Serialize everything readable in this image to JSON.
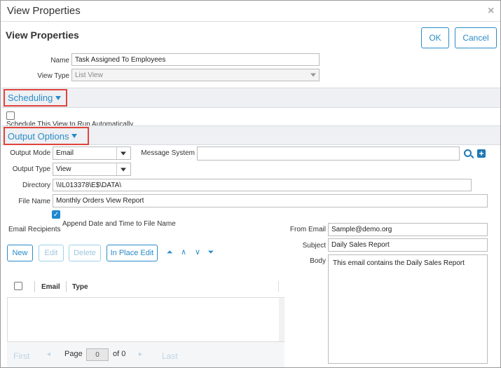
{
  "window": {
    "title": "View Properties",
    "close_glyph": "×"
  },
  "header": {
    "title": "View Properties",
    "ok_label": "OK",
    "cancel_label": "Cancel"
  },
  "general": {
    "name_label": "Name",
    "name_value": "Task Assigned To Employees",
    "view_type_label": "View Type",
    "view_type_value": "List View"
  },
  "scheduling": {
    "title": "Scheduling",
    "checkbox_label": "Schedule This View to Run Automatically",
    "checked": false
  },
  "output_options": {
    "title": "Output Options",
    "output_mode_label": "Output Mode",
    "output_mode_value": "Email",
    "message_system_label": "Message System",
    "message_system_value": "",
    "output_type_label": "Output Type",
    "output_type_value": "View",
    "directory_label": "Directory",
    "directory_value": "\\\\IL013378\\E$\\DATA\\",
    "file_name_label": "File Name",
    "file_name_value": "Monthly  Orders View Report",
    "append_label": "Append Date and Time to File Name",
    "append_checked": true,
    "search_icon": "search-icon",
    "add_icon": "plus-icon"
  },
  "recipients": {
    "label": "Email Recipients",
    "toolbar": {
      "new": "New",
      "edit": "Edit",
      "delete": "Delete",
      "in_place_edit": "In Place Edit"
    },
    "arrows": {
      "top": "⏶",
      "up": "∧",
      "down": "∨",
      "bottom": "⏷"
    },
    "columns": [
      "Email",
      "Type"
    ],
    "rows": [],
    "pager": {
      "first": "First",
      "prev": "◂",
      "page_label": "Page",
      "page_value": "0",
      "of_label": "of 0",
      "next": "▸",
      "last": "Last"
    }
  },
  "email": {
    "from_label": "From Email",
    "from_value": "Sample@demo.org",
    "subject_label": "Subject",
    "subject_value": "Daily Sales Report",
    "body_label": "Body",
    "body_value": "This email contains the Daily Sales Report"
  },
  "colors": {
    "accent": "#2a8cc7",
    "highlight_border": "#e0443c",
    "section_bg": "#eef0f4",
    "checkbox_on": "#1f8ad0"
  }
}
